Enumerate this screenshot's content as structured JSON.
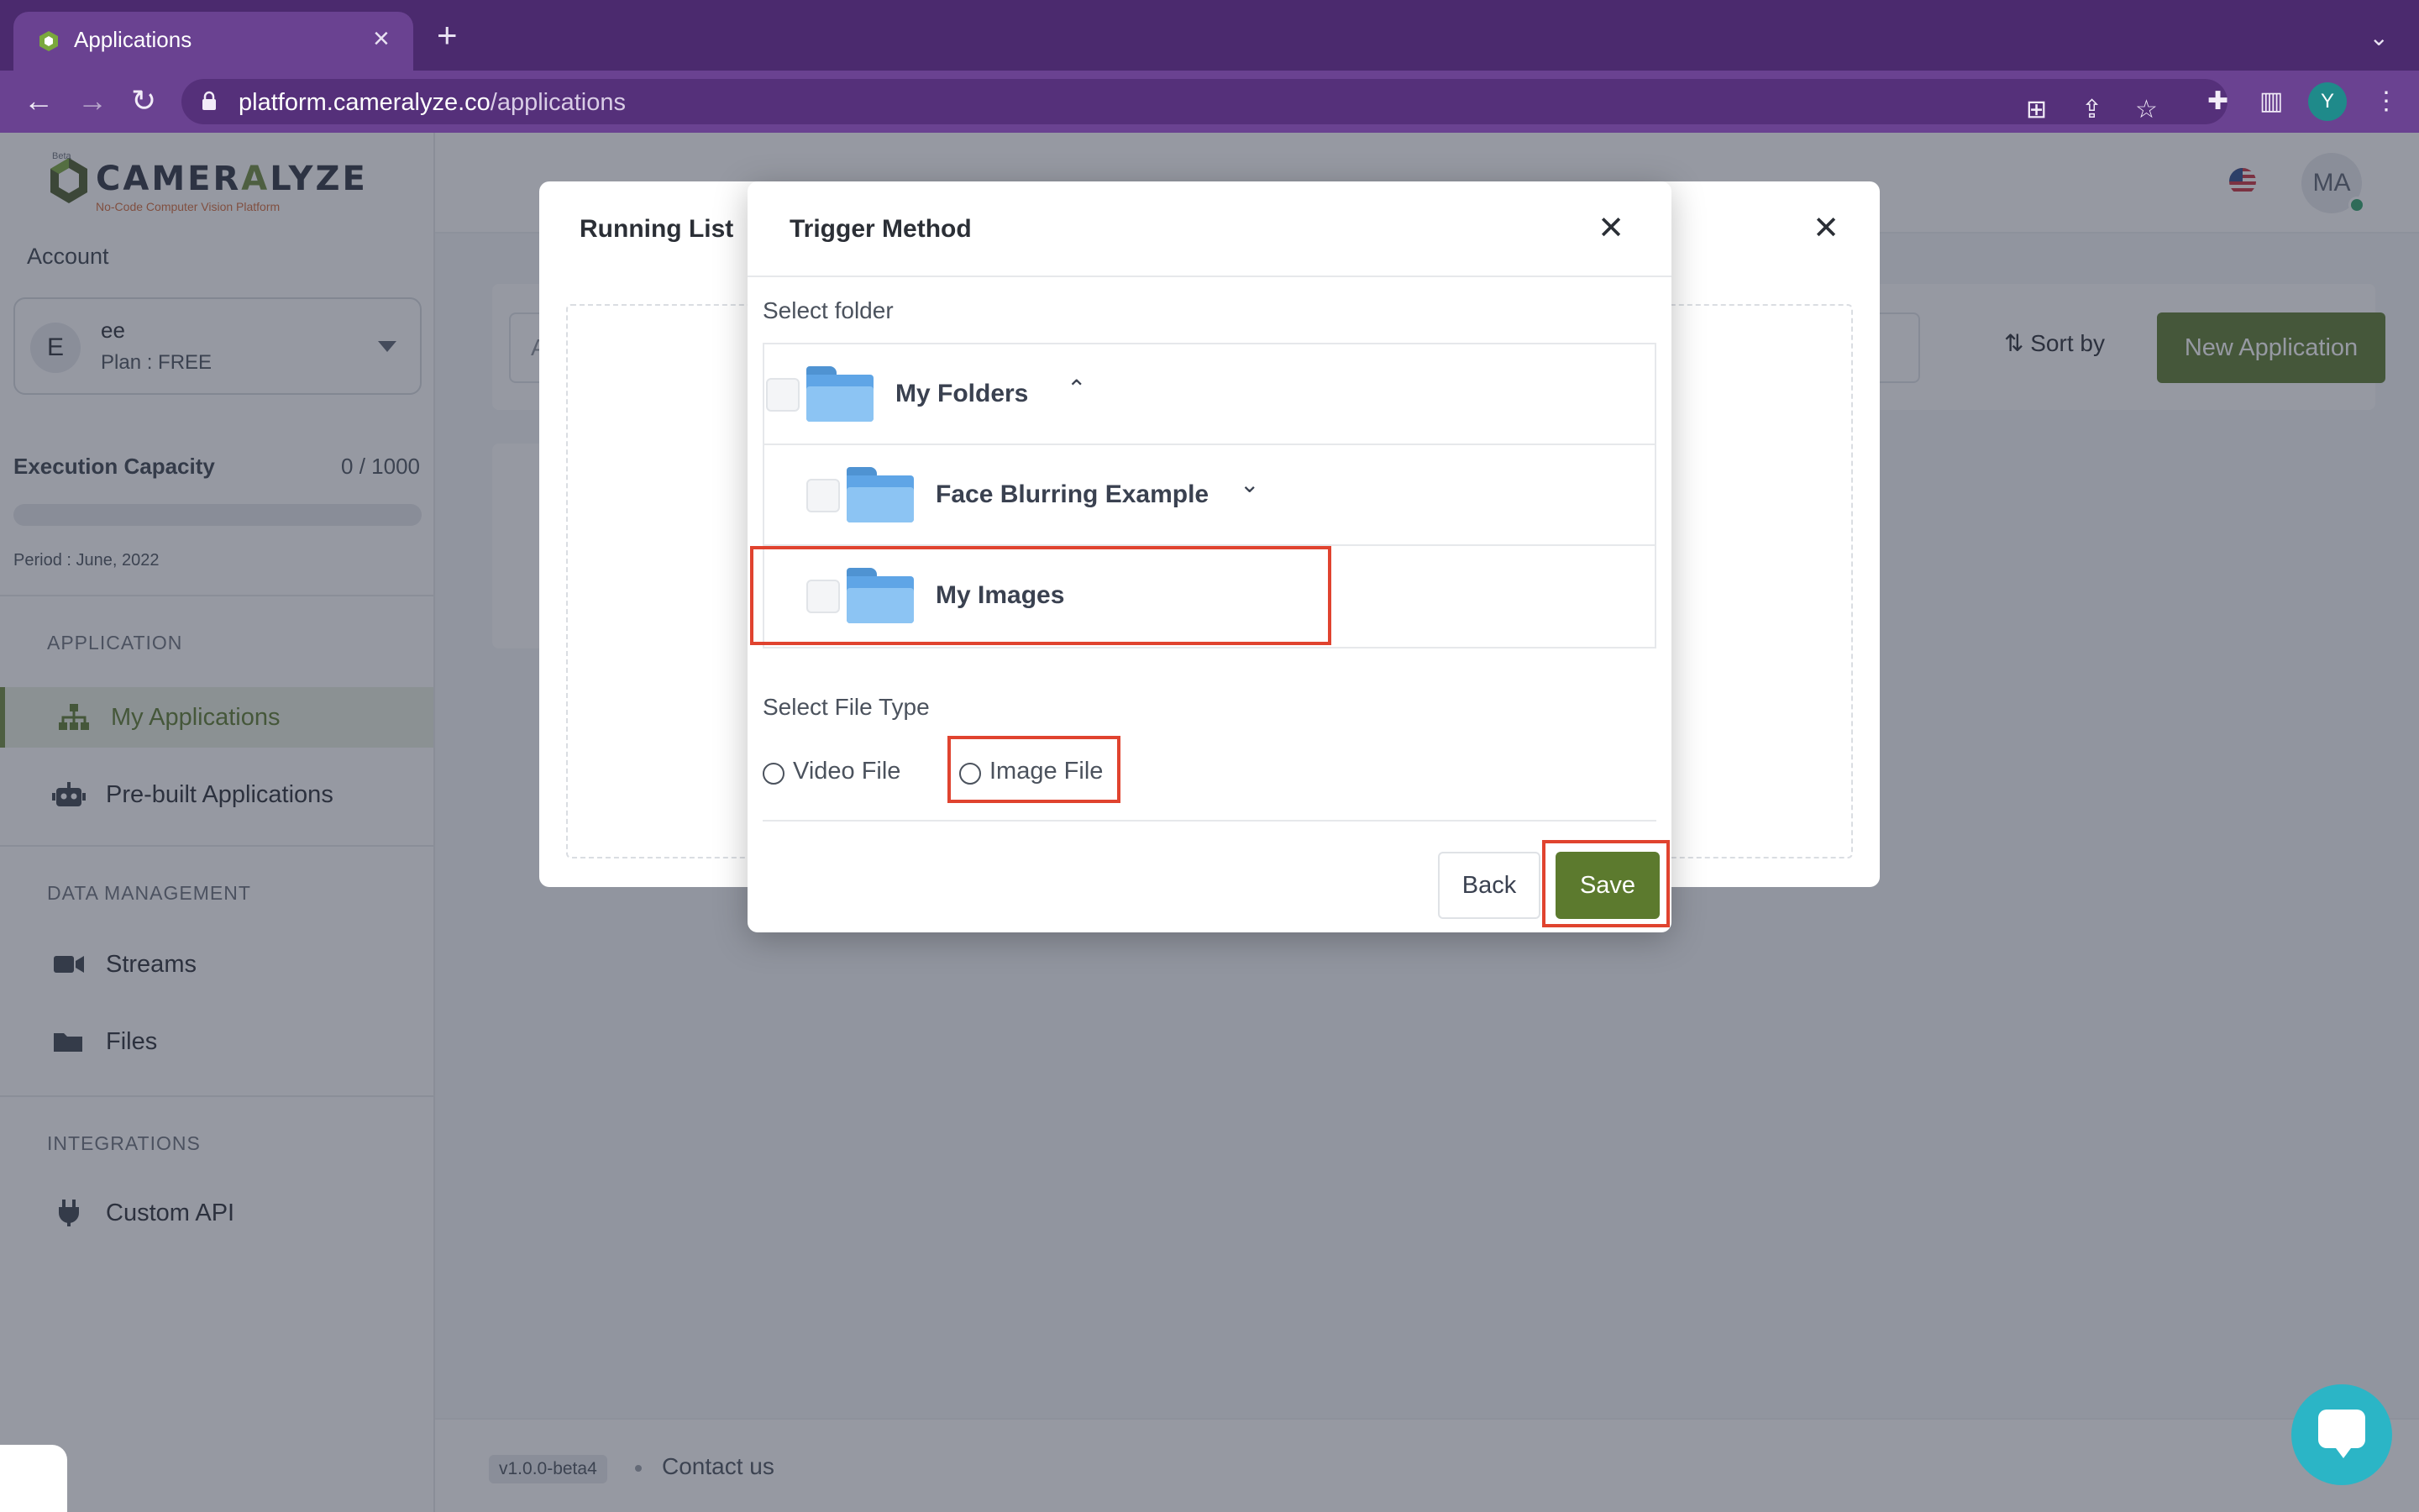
{
  "browser": {
    "tab_title": "Applications",
    "url_domain": "platform.cameralyze.co",
    "url_path": "/applications",
    "profile_initial": "Y"
  },
  "logo": {
    "word_pre": "CAMER",
    "word_a": "A",
    "word_post": "LYZE",
    "tagline": "No-Code Computer Vision Platform",
    "badge": "Beta"
  },
  "sidebar": {
    "account_label": "Account",
    "account": {
      "initial": "E",
      "name": "ee",
      "plan": "Plan : FREE"
    },
    "capacity": {
      "label": "Execution Capacity",
      "value": "0 / 1000",
      "fraction": 0,
      "period": "Period : June, 2022"
    },
    "groups": {
      "application": "APPLICATION",
      "data": "DATA MANAGEMENT",
      "integrations": "INTEGRATIONS"
    },
    "items": {
      "my_apps": "My Applications",
      "prebuilt": "Pre-built Applications",
      "streams": "Streams",
      "files": "Files",
      "custom_api": "Custom API"
    }
  },
  "header": {
    "user_initials": "MA"
  },
  "toolbar": {
    "search_placeholder": "A",
    "sort_label": "Sort by",
    "new_app_label": "New Application"
  },
  "footer": {
    "version": "v1.0.0-beta4",
    "contact": "Contact us"
  },
  "running_modal": {
    "title": "Running List"
  },
  "trigger_modal": {
    "title": "Trigger Method",
    "select_folder_label": "Select folder",
    "folders": {
      "root": "My Folders",
      "child1": "Face Blurring Example",
      "child2": "My Images"
    },
    "file_type_label": "Select File Type",
    "options": {
      "video": "Video File",
      "image": "Image File"
    },
    "back_label": "Back",
    "save_label": "Save"
  },
  "colors": {
    "brand_green": "#5c7a2e",
    "browser_purple": "#6a4291",
    "highlight_red": "#e0432f",
    "folder_blue": "#5fa5e6"
  },
  "icons": [
    "tab-favicon-icon",
    "close-icon",
    "plus-icon",
    "back-arrow-icon",
    "forward-arrow-icon",
    "reload-icon",
    "lock-icon",
    "translate-icon",
    "share-icon",
    "star-icon",
    "extensions-icon",
    "sidepanel-icon",
    "kebab-menu-icon",
    "sitemap-icon",
    "robot-icon",
    "video-camera-icon",
    "folder-icon",
    "plug-icon",
    "sort-icon",
    "chevron-up-icon",
    "chevron-down-icon",
    "flag-icon",
    "chat-icon"
  ]
}
